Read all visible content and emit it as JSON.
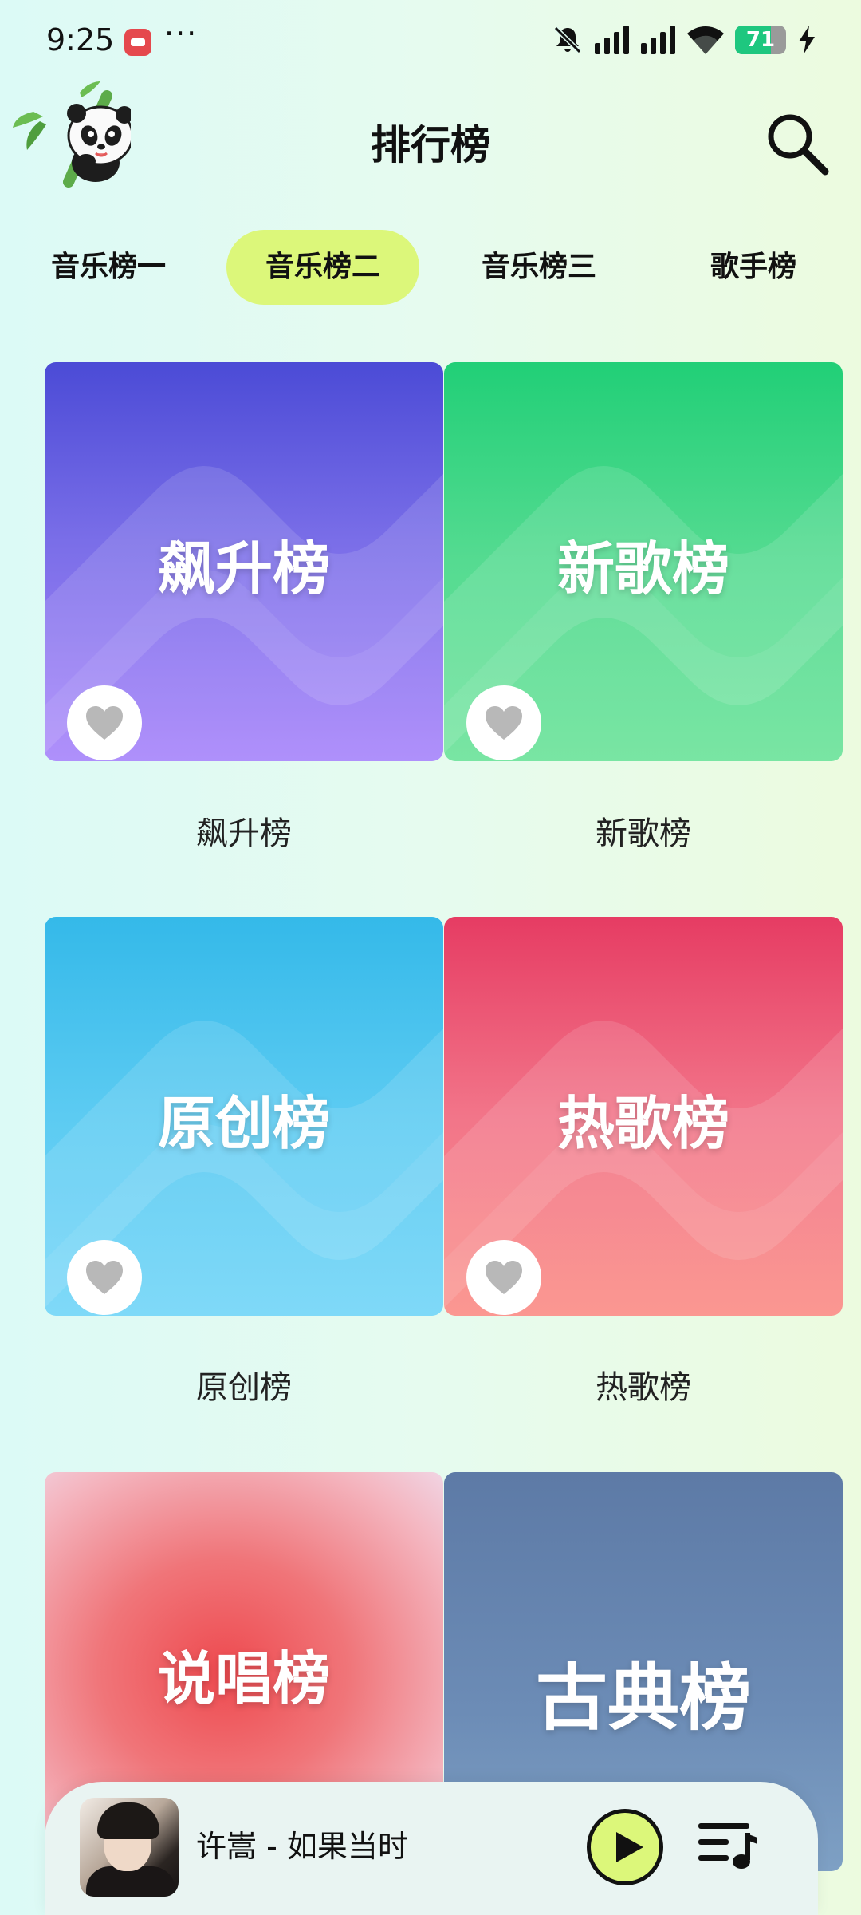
{
  "status_bar": {
    "time": "9:25",
    "dots": "···",
    "battery_level": "71",
    "icons": [
      "app-notification-icon",
      "mute-bell-icon",
      "signal-icon",
      "signal-icon",
      "wifi-icon",
      "battery-icon",
      "charging-icon"
    ]
  },
  "header": {
    "title": "排行榜",
    "search_icon": "search-icon",
    "mascot": "panda-bamboo-logo"
  },
  "tabs": [
    {
      "label": "音乐榜一",
      "active": false
    },
    {
      "label": "音乐榜二",
      "active": true
    },
    {
      "label": "音乐榜三",
      "active": false
    },
    {
      "label": "歌手榜",
      "active": false
    }
  ],
  "charts": [
    {
      "cover_title": "飙升榜",
      "label": "飙升榜",
      "color": "#6a5fe0"
    },
    {
      "cover_title": "新歌榜",
      "label": "新歌榜",
      "color": "#3fd685"
    },
    {
      "cover_title": "原创榜",
      "label": "原创榜",
      "color": "#52c6ef"
    },
    {
      "cover_title": "热歌榜",
      "label": "热歌榜",
      "color": "#ee5a75"
    },
    {
      "cover_title": "说唱榜",
      "label": "",
      "color": "#ee5a5e"
    },
    {
      "cover_title": "古典榜",
      "label": "",
      "color": "#6a89b2"
    }
  ],
  "player": {
    "song": "许嵩 - 如果当时",
    "play_icon": "play-icon",
    "playlist_icon": "playlist-icon"
  },
  "accent_color": "#dcf77a"
}
